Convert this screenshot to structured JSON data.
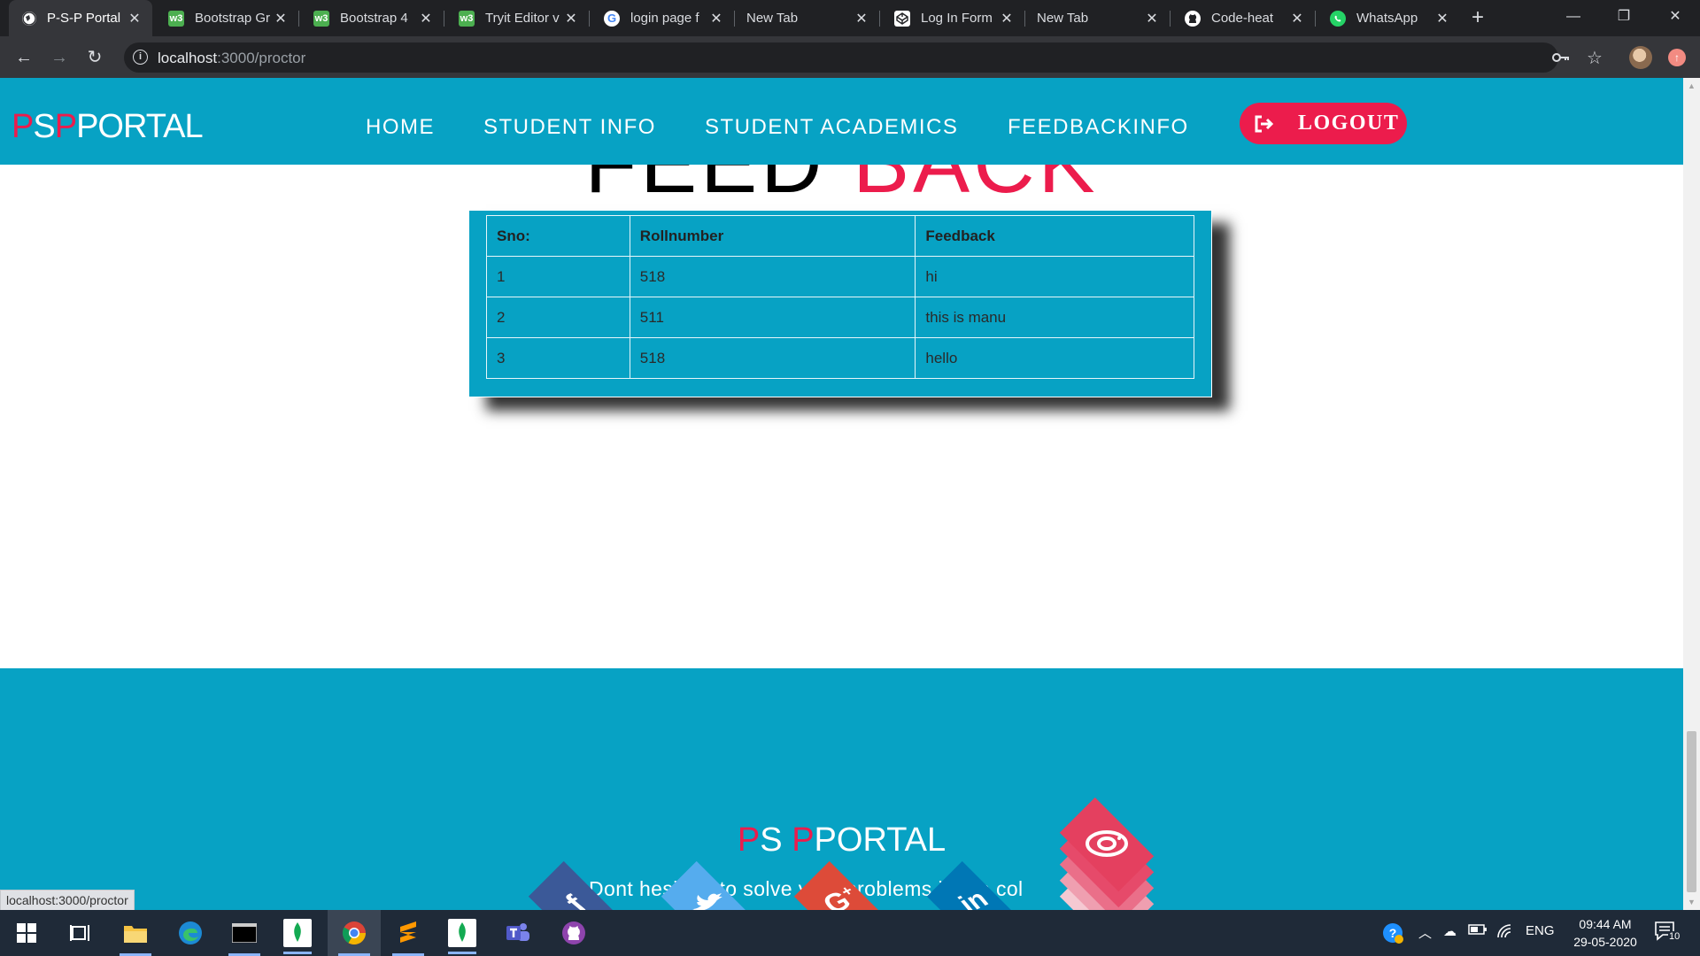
{
  "browser": {
    "tabs": [
      {
        "title": "P-S-P Portal",
        "icon": "globe-icon",
        "active": true
      },
      {
        "title": "Bootstrap Gr",
        "icon": "w3schools-icon"
      },
      {
        "title": "Bootstrap 4",
        "icon": "w3schools-icon"
      },
      {
        "title": "Tryit Editor v",
        "icon": "w3schools-icon"
      },
      {
        "title": "login page f",
        "icon": "google-icon"
      },
      {
        "title": "New Tab",
        "icon": ""
      },
      {
        "title": "Log In Form",
        "icon": "codepen-icon"
      },
      {
        "title": "New Tab",
        "icon": ""
      },
      {
        "title": "Code-heat",
        "icon": "github-icon"
      },
      {
        "title": "WhatsApp",
        "icon": "whatsapp-icon"
      }
    ],
    "url_host": "localhost",
    "url_path": ":3000/proctor",
    "status_url": "localhost:3000/proctor"
  },
  "navbar": {
    "brand_p1": "P",
    "brand_s": "S",
    "brand_p2": "P",
    "brand_rest": "PORTAL",
    "links": [
      "HOME",
      "STUDENT INFO",
      "STUDENT ACADEMICS",
      "FEEDBACKINFO"
    ],
    "logout": "LOGOUT"
  },
  "heading": {
    "part1": "FEED",
    "part2": "BACK"
  },
  "table": {
    "headers": [
      "Sno:",
      "Rollnumber",
      "Feedback"
    ],
    "rows": [
      [
        "1",
        "518",
        "hi"
      ],
      [
        "2",
        "511",
        "this is manu"
      ],
      [
        "3",
        "518",
        "hello"
      ]
    ]
  },
  "footer": {
    "brand_p1": "P",
    "brand_s": "S ",
    "brand_p2": "P",
    "brand_rest": "PORTAL",
    "text": "Dont hesitate to solve your problems in the col",
    "social": [
      {
        "name": "facebook-icon",
        "color": "#3b5998"
      },
      {
        "name": "twitter-icon",
        "color": "#55acee"
      },
      {
        "name": "google-plus-icon",
        "color": "#dd4b39"
      },
      {
        "name": "linkedin-icon",
        "color": "#0077b5"
      },
      {
        "name": "instagram-icon",
        "color": "#e4405f"
      }
    ]
  },
  "taskbar": {
    "lang": "ENG",
    "time": "09:44 AM",
    "date": "29-05-2020",
    "notifications": "10"
  },
  "colors": {
    "brand_blue": "#07a2c4",
    "brand_red": "#ec1c4c"
  }
}
